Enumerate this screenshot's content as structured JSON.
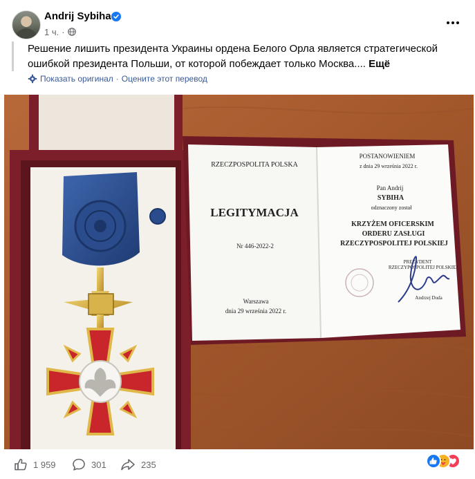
{
  "post": {
    "author": "Andrij Sybiha",
    "time": "1 ч.",
    "text": "Решение лишить президента Украины ордена Белого Орла является стратегической ошибкой президента Польши, от которой побеждает только Москва....",
    "more": "Ещё",
    "show_original": "Показать оригинал",
    "separator": "·",
    "rate_translation": "Оцените этот перевод"
  },
  "photo": {
    "left_page_header": "RZECZPOSPOLITA POLSKA",
    "left_page_title": "LEGITYMACJA",
    "left_page_number": "Nr 446-2022-2",
    "left_page_city": "Warszawa",
    "left_page_date": "dnia 29 września 2022 r.",
    "right_page_header": "POSTANOWIENIEM",
    "right_page_date": "z dnia 29 września 2022 r.",
    "right_page_recipient_prefix": "Pan Andrij",
    "right_page_recipient_name": "SYBIHA",
    "right_page_awarded": "odznaczony został",
    "right_page_award_line1": "KRZYŻEM OFICERSKIM",
    "right_page_award_line2": "ORDERU ZASŁUGI",
    "right_page_award_line3": "RZECZYPOSPOLITEJ POLSKIEJ",
    "right_page_president_line1": "PREZYDENT",
    "right_page_president_line2": "RZECZYPOSPOLITEJ POLSKIEJ",
    "right_page_signatory": "Andrzej Duda"
  },
  "footer": {
    "likes": "1 959",
    "comments": "301",
    "shares": "235"
  },
  "colors": {
    "link": "#385898",
    "muted": "#65676b",
    "verified": "#1877f2",
    "ribbon": "#2e4f8e",
    "case_red": "#7d1f2a"
  },
  "icons": [
    "verified-badge-icon",
    "globe-icon",
    "more-options-icon",
    "translate-gear-icon",
    "like-icon",
    "comment-icon",
    "share-icon",
    "like-reaction-icon",
    "care-reaction-icon",
    "love-reaction-icon"
  ]
}
